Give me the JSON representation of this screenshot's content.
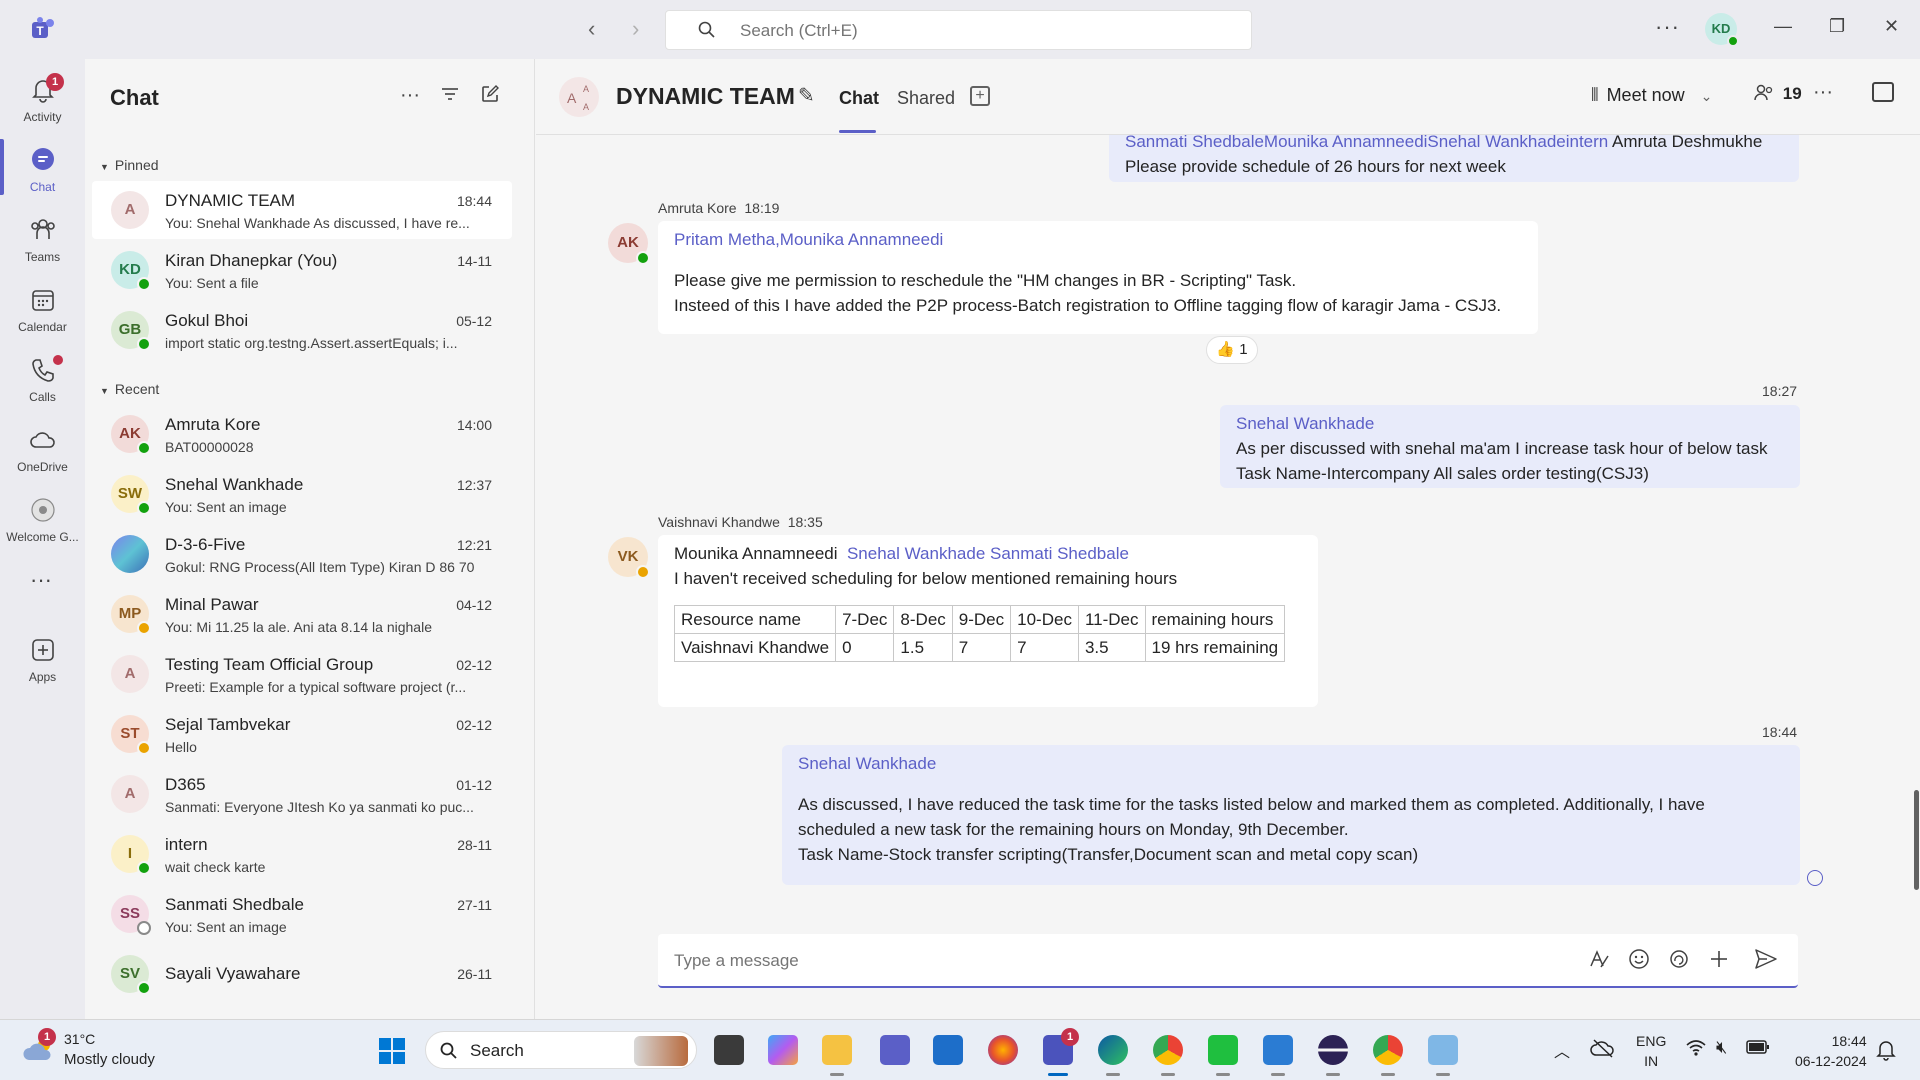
{
  "titlebar": {
    "search_placeholder": "Search (Ctrl+E)",
    "user_initials": "KD"
  },
  "rail": {
    "items": [
      {
        "label": "Activity",
        "badge": "1"
      },
      {
        "label": "Chat"
      },
      {
        "label": "Teams"
      },
      {
        "label": "Calendar"
      },
      {
        "label": "Calls"
      },
      {
        "label": "OneDrive"
      },
      {
        "label": "Welcome G..."
      },
      {
        "label": "Apps"
      }
    ]
  },
  "chatlist": {
    "title": "Chat",
    "pinned_label": "Pinned",
    "recent_label": "Recent",
    "pinned": [
      {
        "initials": "A",
        "name": "DYNAMIC TEAM",
        "time": "18:44",
        "preview": "You: Snehal Wankhade   As discussed, I have re..."
      },
      {
        "initials": "KD",
        "name": "Kiran Dhanepkar (You)",
        "time": "14-11",
        "preview": "You: Sent a file"
      },
      {
        "initials": "GB",
        "name": "Gokul Bhoi",
        "time": "05-12",
        "preview": "import static org.testng.Assert.assertEquals;   i..."
      }
    ],
    "recent": [
      {
        "initials": "AK",
        "name": "Amruta Kore",
        "time": "14:00",
        "preview": "BAT00000028"
      },
      {
        "initials": "SW",
        "name": "Snehal Wankhade",
        "time": "12:37",
        "preview": "You: Sent an image"
      },
      {
        "initials": "",
        "name": "D-3-6-Five",
        "time": "12:21",
        "preview": "Gokul: RNG Process(All Item Type) Kiran D 86 70"
      },
      {
        "initials": "MP",
        "name": "Minal Pawar",
        "time": "04-12",
        "preview": "You: Mi 11.25 la ale. Ani ata 8.14 la nighale"
      },
      {
        "initials": "A",
        "name": "Testing Team Official Group",
        "time": "02-12",
        "preview": "Preeti: Example for a typical software project (r..."
      },
      {
        "initials": "ST",
        "name": "Sejal Tambvekar",
        "time": "02-12",
        "preview": "Hello"
      },
      {
        "initials": "A",
        "name": "D365",
        "time": "01-12",
        "preview": "Sanmati: Everyone JItesh Ko ya sanmati ko puc..."
      },
      {
        "initials": "I",
        "name": "intern",
        "time": "28-11",
        "preview": "wait check karte"
      },
      {
        "initials": "SS",
        "name": "Sanmati Shedbale",
        "time": "27-11",
        "preview": "You: Sent an image"
      },
      {
        "initials": "SV",
        "name": "Sayali Vyawahare",
        "time": "26-11",
        "preview": ""
      }
    ]
  },
  "conversation": {
    "title": "DYNAMIC TEAM",
    "tabs": [
      "Chat",
      "Shared"
    ],
    "meet_label": "Meet now",
    "participants_count": "19",
    "messages": [
      {
        "partial_top_mentions": "Sanmati ShedbaleMounika AnnamneediSnehal Wankhadeintern",
        "partial_top_name": " Amruta Deshmukhe",
        "partial_top_text": "Please provide schedule of 26 hours for next week"
      },
      {
        "sender": "Amruta Kore",
        "time": "18:19",
        "initials": "AK",
        "mentions": "Pritam Metha,Mounika Annamneedi",
        "line1": "Please give me permission to reschedule the \"HM changes in BR - Scripting\" Task.",
        "line2": "Insteed of this I have added the P2P process-Batch registration to Offline tagging flow of karagir Jama - CSJ3.",
        "reaction_count": "1"
      },
      {
        "time": "18:27",
        "mention": "Snehal Wankhade",
        "line1": "As per discussed with snehal ma'am I increase task hour of below task",
        "line2": "Task Name-Intercompany All sales order testing(CSJ3)"
      },
      {
        "sender": "Vaishnavi Khandwe",
        "time": "18:35",
        "initials": "VK",
        "plain_name": "Mounika Annamneedi",
        "mentions": "Snehal Wankhade Sanmati Shedbale",
        "line1": "I haven't received scheduling for below mentioned remaining  hours",
        "table_header": [
          "Resource name",
          "7-Dec",
          "8-Dec",
          "9-Dec",
          "10-Dec",
          "11-Dec",
          "remaining hours"
        ],
        "table_row": [
          "Vaishnavi Khandwe",
          "0",
          "1.5",
          "7",
          "7",
          "3.5",
          "19 hrs remaining"
        ]
      },
      {
        "time": "18:44",
        "mention": "Snehal Wankhade",
        "line1": "As discussed, I have reduced the task time for the tasks listed below and marked them as completed. Additionally, I have",
        "line2": "scheduled a new task for the remaining hours on Monday, 9th December.",
        "line3": "Task Name-Stock transfer scripting(Transfer,Document scan and metal copy scan)"
      }
    ],
    "compose_placeholder": "Type a message"
  },
  "taskbar": {
    "weather_temp": "31°C",
    "weather_desc": "Mostly cloudy",
    "weather_badge": "1",
    "search_label": "Search",
    "teams_badge": "1",
    "lang_line1": "ENG",
    "lang_line2": "IN",
    "clock_time": "18:44",
    "clock_date": "06-12-2024"
  }
}
